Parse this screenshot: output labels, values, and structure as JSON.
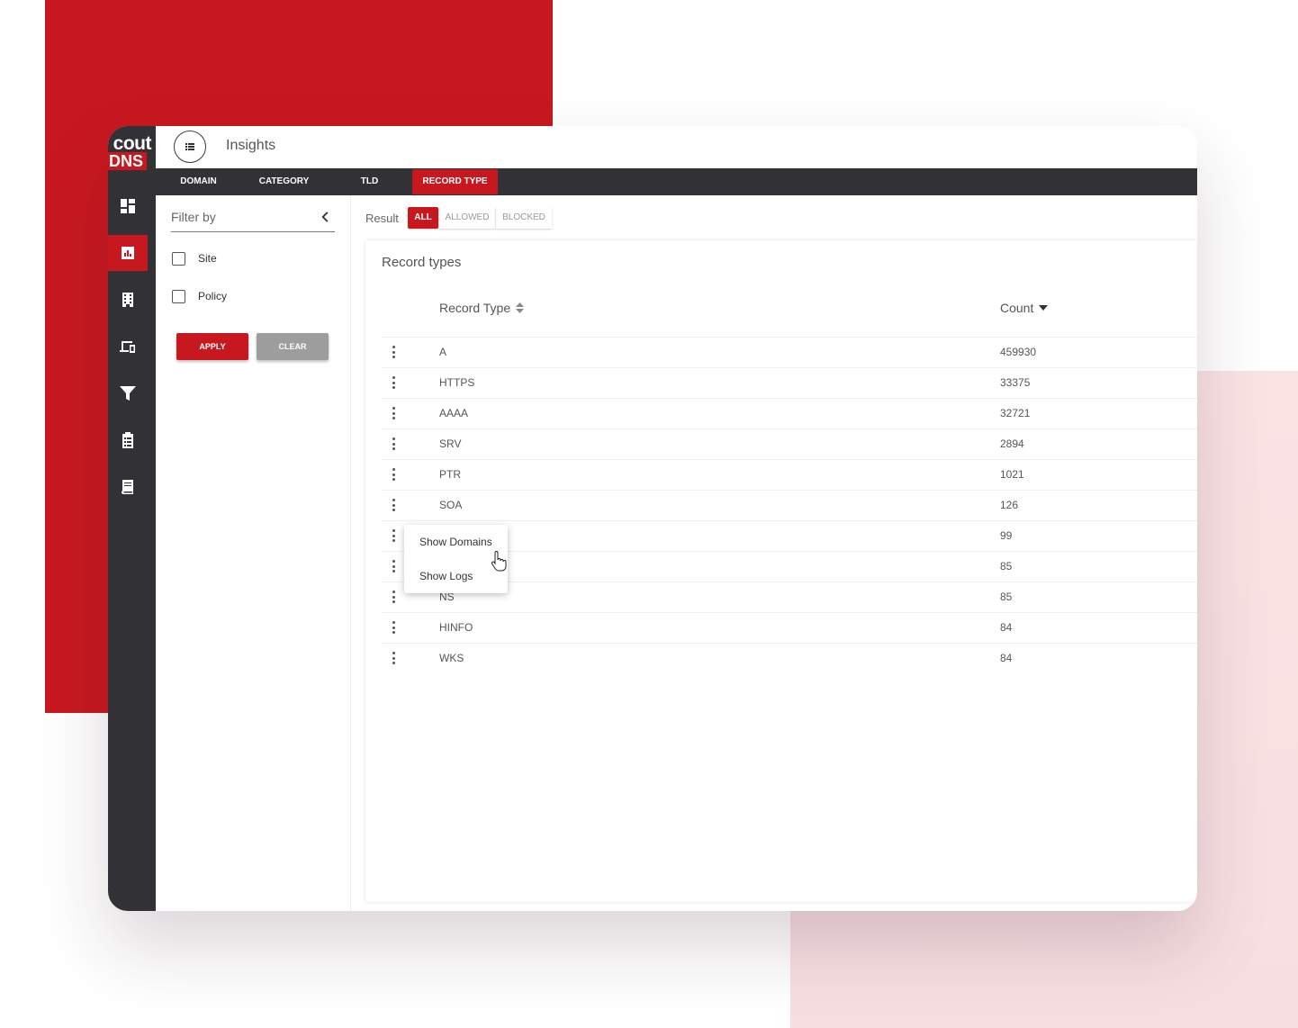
{
  "app": {
    "logo_top": "cout",
    "logo_bottom": "DNS",
    "page_title": "Insights"
  },
  "colors": {
    "accent": "#c8181f",
    "sidebar": "#323136",
    "pink": "#f7dfe1"
  },
  "sidebar": {
    "items": [
      {
        "icon": "dashboard-icon",
        "active": false
      },
      {
        "icon": "insights-chart-icon",
        "active": true
      },
      {
        "icon": "building-icon",
        "active": false
      },
      {
        "icon": "devices-icon",
        "active": false
      },
      {
        "icon": "filter-icon",
        "active": false
      },
      {
        "icon": "clipboard-icon",
        "active": false
      },
      {
        "icon": "book-icon",
        "active": false
      }
    ]
  },
  "tabs": [
    {
      "label": "DOMAIN",
      "active": false
    },
    {
      "label": "CATEGORY",
      "active": false
    },
    {
      "label": "TLD",
      "active": false
    },
    {
      "label": "RECORD TYPE",
      "active": true
    }
  ],
  "filter": {
    "title": "Filter by",
    "options": [
      {
        "label": "Site",
        "checked": false
      },
      {
        "label": "Policy",
        "checked": false
      }
    ],
    "apply_label": "APPLY",
    "clear_label": "CLEAR"
  },
  "result": {
    "label": "Result",
    "options": [
      "ALL",
      "ALLOWED",
      "BLOCKED"
    ],
    "selected": "ALL"
  },
  "table": {
    "title": "Record types",
    "columns": [
      "Record Type",
      "Count"
    ],
    "rows": [
      {
        "type": "A",
        "count": "459930"
      },
      {
        "type": "HTTPS",
        "count": "33375"
      },
      {
        "type": "AAAA",
        "count": "32721"
      },
      {
        "type": "SRV",
        "count": "2894"
      },
      {
        "type": "PTR",
        "count": "1021"
      },
      {
        "type": "SOA",
        "count": "126"
      },
      {
        "type": "",
        "count": "99"
      },
      {
        "type": "",
        "count": "85"
      },
      {
        "type": "NS",
        "count": "85"
      },
      {
        "type": "HINFO",
        "count": "84"
      },
      {
        "type": "WKS",
        "count": "84"
      }
    ]
  },
  "context_menu": {
    "items": [
      "Show Domains",
      "Show Logs"
    ]
  }
}
